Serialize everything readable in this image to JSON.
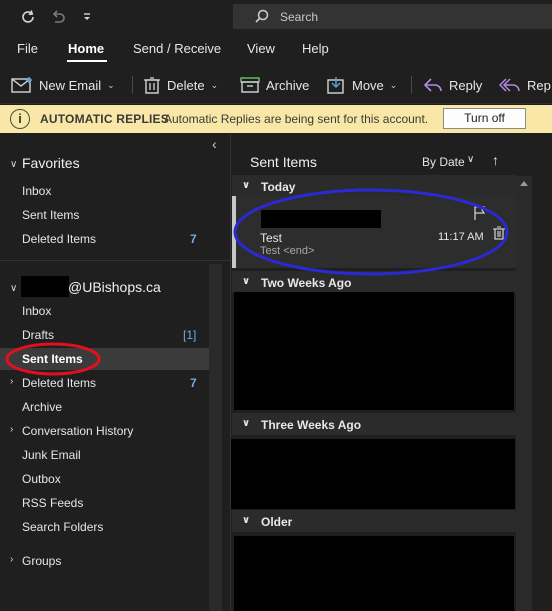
{
  "titlebar": {
    "search_placeholder": "Search",
    "icons": [
      "sync-icon",
      "undo-icon",
      "customize-toolbar-icon",
      "search-icon"
    ]
  },
  "menu": {
    "tabs": [
      {
        "label": "File"
      },
      {
        "label": "Home",
        "active": true
      },
      {
        "label": "Send / Receive"
      },
      {
        "label": "View"
      },
      {
        "label": "Help"
      }
    ]
  },
  "ribbon": {
    "new_email": "New Email",
    "delete": "Delete",
    "archive": "Archive",
    "move": "Move",
    "reply": "Reply",
    "reply_all_partial": "Rep"
  },
  "infobar": {
    "title": "AUTOMATIC REPLIES",
    "message": "Automatic Replies are being sent for this account.",
    "button": "Turn off",
    "info_glyph": "i"
  },
  "folders": {
    "favorites_header": "Favorites",
    "favorites": [
      {
        "label": "Inbox"
      },
      {
        "label": "Sent Items"
      },
      {
        "label": "Deleted Items",
        "count": "7"
      }
    ],
    "account_suffix": "@UBishops.ca",
    "account_items": [
      {
        "label": "Inbox"
      },
      {
        "label": "Drafts",
        "count": "[1]"
      },
      {
        "label": "Sent Items",
        "selected": true
      },
      {
        "label": "Deleted Items",
        "count": "7"
      },
      {
        "label": "Archive"
      },
      {
        "label": "Conversation History"
      },
      {
        "label": "Junk Email"
      },
      {
        "label": "Outbox"
      },
      {
        "label": "RSS Feeds"
      },
      {
        "label": "Search Folders"
      }
    ],
    "groups": "Groups",
    "collapse_glyph": "‹"
  },
  "message_list": {
    "title": "Sent Items",
    "sort": "By Date",
    "groups": [
      "Today",
      "Two Weeks Ago",
      "Three Weeks Ago",
      "Older"
    ],
    "message": {
      "subject": "Test",
      "preview": "Test <end>",
      "time": "11:17 AM"
    }
  },
  "colors": {
    "background": "#1f1f1f",
    "infobar": "#f8e7a6",
    "count_blue": "#72a9e8",
    "annotation_red": "#e0101e",
    "annotation_blue": "#2a2ad4"
  }
}
